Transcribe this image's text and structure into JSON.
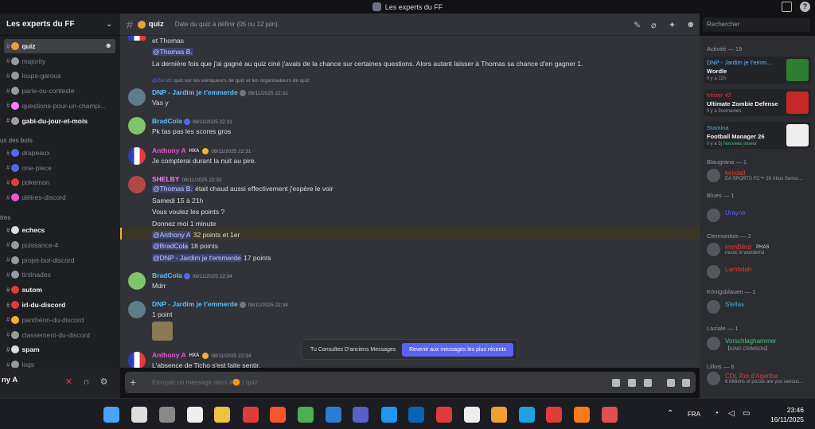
{
  "window": {
    "title": "Les experts du FF"
  },
  "server": {
    "name": "Les experts du FF"
  },
  "channels": [
    {
      "name": "quiz",
      "active": true,
      "color": "#e8a23a"
    },
    {
      "name": "majority",
      "color": "#949ba4"
    },
    {
      "name": "loups-garous",
      "color": "#949ba4"
    },
    {
      "name": "parie-ou-conteste",
      "color": "#949ba4"
    },
    {
      "name": "questions-pour-un-champi...",
      "color": "#f47fff"
    },
    {
      "name": "gabi-du-jour-et-mois",
      "bright": true,
      "color": "#a0a0a0"
    }
  ],
  "category_bots": "ux des bots",
  "bot_channels": [
    {
      "name": "drapeaux",
      "color": "#5865f2"
    },
    {
      "name": "one-piece",
      "color": "#5865f2"
    },
    {
      "name": "pokemon",
      "color": "#e23b3b"
    },
    {
      "name": "délires-discord",
      "color": "#e05bd0"
    }
  ],
  "category_other": "tres",
  "other_channels": [
    {
      "name": "echecs",
      "bright": true,
      "color": "#dbdee1"
    },
    {
      "name": "puissance-4",
      "color": "#949ba4"
    },
    {
      "name": "projet-bot-discord",
      "color": "#949ba4"
    },
    {
      "name": "tintinades",
      "color": "#949ba4"
    },
    {
      "name": "sutom",
      "bright": true,
      "color": "#e23b3b"
    },
    {
      "name": "irl-du-discord",
      "bright": true,
      "color": "#e23b3b"
    },
    {
      "name": "panthéon-du-discord",
      "color": "#f0b232"
    },
    {
      "name": "classement-du-discord",
      "color": "#949ba4"
    },
    {
      "name": "spam",
      "bright": true,
      "color": "#dbdee1"
    },
    {
      "name": "logs",
      "color": "#949ba4"
    }
  ],
  "user": {
    "name": "ny A"
  },
  "header": {
    "channel": "quiz",
    "topic": "Date du quiz à définir (05 ou 12 juin)"
  },
  "search": {
    "placeholder": "Rechercher"
  },
  "messages": {
    "m0": {
      "l1": "et Thomas",
      "l2": "@Thomas B.",
      "l3": "La dernière fois que j'ai gagné au quiz ciné j'avais de la chance sur certaines questions. Alors autant laisser à Thomas sa chance d'en gagner 1."
    },
    "m1": {
      "reply_name": "@Zerath",
      "reply_text": "quiz sur les vainqueurs de quiz et les organisateurs de quiz",
      "author": "DNP - Jardim je t'emmerde",
      "ts": "08/11/2025 22:31",
      "l1": "Vas y"
    },
    "m2": {
      "author": "BradCola",
      "ts": "08/11/2025 22:31",
      "l1": "Pk tas pas les scores gros"
    },
    "m3": {
      "author": "Anthony A",
      "tag": "HXA",
      "ts": "08/11/2025 22:31",
      "l1": "Je compterai durant la nuit au pire."
    },
    "m4": {
      "author": "SHELBY",
      "ts": "08/11/2025 22:32",
      "mention": "@Thomas B.",
      "l1": "était chaud aussi effectivement j'espère le voir",
      "l2": "Samedi 15 à 21h",
      "l3": "Vous voulez les points ?",
      "l4": "Donnez moi 1 minute",
      "r1m": "@Anthony A",
      "r1": "32 points et 1er",
      "r2m": "@BradCola",
      "r2": "18 points",
      "r3m": "@DNP - Jardim je t'emmerde",
      "r3": "17 points"
    },
    "m5": {
      "author": "BradCola",
      "ts": "08/11/2025 22:34",
      "l1": "Mdrr"
    },
    "m6": {
      "author": "DNP - Jardim je t'emmerde",
      "ts": "08/11/2025 22:34",
      "l1": "1 point"
    },
    "m7": {
      "author": "Anthony A",
      "tag": "HXA",
      "ts": "08/11/2025 22:34",
      "l1": "L'absence de Ticho s'est faite sentir."
    }
  },
  "banner": {
    "text": "Tu Consultes D'anciens Messages",
    "button": "Revenir aux messages les plus récents"
  },
  "composer": {
    "placeholder": "Envoyer un message dans #",
    "channel": "quiz"
  },
  "activity": {
    "header": "Activité — 19",
    "cards": [
      {
        "name": "DNP - Jardim je t'emm...",
        "game": "Wordle",
        "time": "Il y a 11h",
        "color": "#5cc0ff"
      },
      {
        "name": "Mister 42",
        "game": "Ultimate Zombie Defense",
        "time": "Il y a 3semaines",
        "color": "#e23b3b"
      },
      {
        "name": "Stamina",
        "game": "Football Manager 26",
        "time": "Il y a 5j",
        "extra": "Nouveau joueur",
        "color": "#4fa8c8"
      }
    ]
  },
  "groups": [
    {
      "label": "Blaugrana — 1"
    },
    {
      "label": "Blues — 1"
    },
    {
      "label": "Clermontois — 2"
    },
    {
      "label": "Königsblauen — 1"
    },
    {
      "label": "Laziale — 1"
    },
    {
      "label": "Lillois — 6"
    }
  ],
  "members": [
    {
      "name": "kendall",
      "status": "EA SPORTS FC™ 26 Xbox Series...",
      "color": "#e23b3b"
    },
    {
      "name": "Urayne",
      "color": "#5865f2"
    },
    {
      "name": "immBlind",
      "tag": "PHAS",
      "status": "music is wonderful",
      "color": "#e23b3b"
    },
    {
      "name": "Lambdah",
      "color": "#e23b3b"
    },
    {
      "name": "Stellas",
      "color": "#4fa8c8"
    },
    {
      "name": "Vorschlaghammer",
      "status": "【KING CRIMSON】",
      "color": "#43c27a"
    },
    {
      "name": "CDL Roi d'Agartha",
      "status": "6 Millions of pizzas are you serious...",
      "color": "#e23b3b"
    }
  ],
  "taskbar": {
    "lang": "FRA",
    "time": "23:46",
    "date": "16/11/2025"
  }
}
